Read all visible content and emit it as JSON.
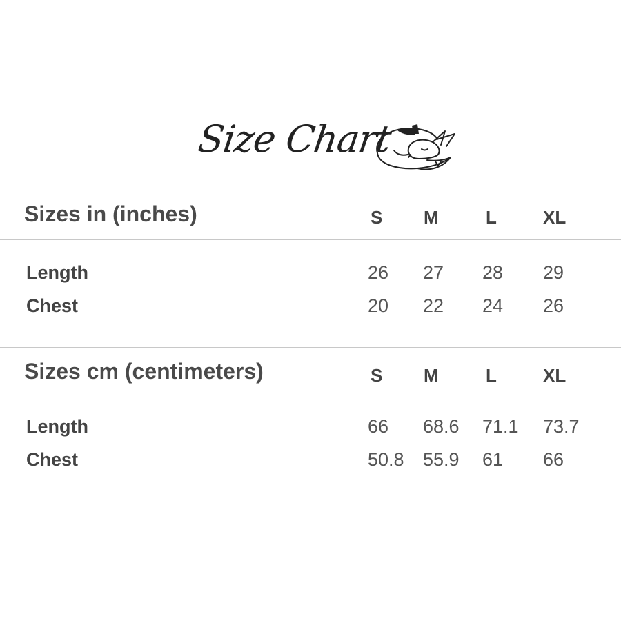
{
  "header": {
    "title": "Size Chart"
  },
  "inches": {
    "title": "Sizes in (inches)",
    "sizes": [
      "S",
      "M",
      "L",
      "XL"
    ],
    "rows": [
      {
        "label": "Length",
        "values": [
          "26",
          "27",
          "28",
          "29"
        ]
      },
      {
        "label": "Chest",
        "values": [
          "20",
          "22",
          "24",
          "26"
        ]
      }
    ]
  },
  "cm": {
    "title": "Sizes cm (centimeters)",
    "sizes": [
      "S",
      "M",
      "L",
      "XL"
    ],
    "rows": [
      {
        "label": "Length",
        "values": [
          "66",
          "68.6",
          "71.1",
          "73.7"
        ]
      },
      {
        "label": "Chest",
        "values": [
          "50.8",
          "55.9",
          "61",
          "66"
        ]
      }
    ]
  },
  "colors": {
    "text": "#444444",
    "rule": "#c8c8c8"
  },
  "icons": {
    "logo": "sleeping-fox-icon"
  }
}
